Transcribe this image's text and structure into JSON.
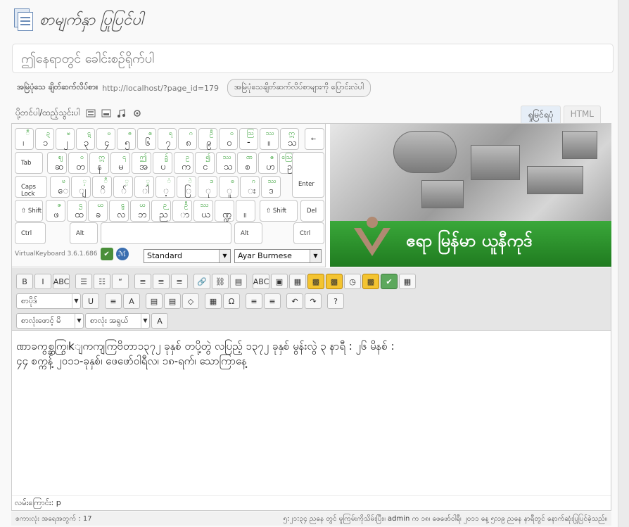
{
  "header": {
    "title": "စာမျက်နှာ ပြုပြင်ပါ"
  },
  "title_field": {
    "placeholder": "ဤနေရာတွင် ခေါင်းစဉ်ရိုက်ပါ"
  },
  "permalink": {
    "label": "အမြဲပုံသေ ချိတ်ဆက်လိပ်စာ။",
    "url": "http://localhost/?page_id=179",
    "button": "အမြဲပုံသေချိတ်ဆက်လိပ်စာများကို ပြောင်းလဲပါ"
  },
  "media": {
    "label": "ပို့တင်ပါ/ထည့်သွင်းပါ"
  },
  "tabs": [
    {
      "label": "ရှုမြင်ရပုံ"
    },
    {
      "label": "HTML"
    }
  ],
  "keyboard": {
    "row1": [
      {
        "m": "၊",
        "s": "ဳ"
      },
      {
        "m": "၁",
        "s": "ဍ"
      },
      {
        "m": "၂",
        "s": "ၑ"
      },
      {
        "m": "၃",
        "s": "ဋ"
      },
      {
        "m": "၄",
        "s": "ၓ"
      },
      {
        "m": "၅",
        "s": "ၔ"
      },
      {
        "m": "၆",
        "s": "ၕ"
      },
      {
        "m": "၇",
        "s": "ရ"
      },
      {
        "m": "၈",
        "s": "ဂ"
      },
      {
        "m": "၉",
        "s": "ဦ"
      },
      {
        "m": "၀",
        "s": "ဝ"
      },
      {
        "m": "-",
        "s": "ဩ"
      },
      {
        "m": "။",
        "s": "ဿ"
      },
      {
        "m": "သ",
        "s": "ဣ"
      }
    ],
    "row2": [
      {
        "m": "ဆ",
        "s": "ဈ"
      },
      {
        "m": "တ",
        "s": "ဝ"
      },
      {
        "m": "န",
        "s": "ဣ"
      },
      {
        "m": "မ",
        "s": "၎"
      },
      {
        "m": "အ",
        "s": "ဤ"
      },
      {
        "m": "ပ",
        "s": "၌"
      },
      {
        "m": "က",
        "s": "ဥ"
      },
      {
        "m": "င",
        "s": "၍"
      },
      {
        "m": "သ",
        "s": "ဿ"
      },
      {
        "m": "စ",
        "s": "ဏ"
      },
      {
        "m": "ဟ",
        "s": "ဧ"
      },
      {
        "m": "ဥ",
        "s": "ဪ"
      }
    ],
    "row3": [
      {
        "m": "ေ",
        "s": "ဗ"
      },
      {
        "m": "ျ",
        "s": "ှ"
      },
      {
        "m": "ိ",
        "s": "ီ"
      },
      {
        "m": "်",
        "s": "္"
      },
      {
        "m": "ါ",
        "s": "ွ"
      },
      {
        "m": "့",
        "s": "ံ"
      },
      {
        "m": "ြ",
        "s": "ဲ"
      },
      {
        "m": "ု",
        "s": "ဒ"
      },
      {
        "m": "ူ",
        "s": "ဓ"
      },
      {
        "m": "း",
        "s": "ဂ"
      },
      {
        "m": "ဒ",
        "s": "ဿ"
      }
    ],
    "row4": [
      {
        "m": "ဖ",
        "s": "ဇ"
      },
      {
        "m": "ထ",
        "s": "ဌ"
      },
      {
        "m": "ခ",
        "s": "ဃ"
      },
      {
        "m": "လ",
        "s": "ဠ"
      },
      {
        "m": "ဘ",
        "s": "ယ"
      },
      {
        "m": "ည",
        "s": "ဉ"
      },
      {
        "m": "ာ",
        "s": "ဦ"
      },
      {
        "m": "ယ",
        "s": "ဿ"
      },
      {
        "m": "ဏ္ဍ",
        "s": ""
      },
      {
        "m": "။",
        "s": ""
      }
    ],
    "labels": {
      "tab": "Tab",
      "caps": "Caps Lock",
      "enter": "Enter",
      "shift_l": "⇧ Shift",
      "shift_r": "⇧ Shift",
      "del": "Del",
      "ctrl_l": "Ctrl",
      "alt_l": "Alt",
      "alt_r": "Alt",
      "ctrl_r": "Ctrl",
      "back": "←"
    },
    "version": "VirtualKeyboard 3.6.1.686",
    "layout_select": "Standard",
    "lang_select": "Ayar Burmese"
  },
  "banner": {
    "brand": "ဧရာ မြန်မာ ယူနီကုဒ်"
  },
  "toolbar": {
    "row1": [
      "B",
      "I",
      "ABC",
      "☰",
      "☷",
      "“",
      "≡",
      "≡",
      "≡",
      "🔗",
      "⛓",
      "▤",
      "ABC",
      "▣",
      "▦",
      "▩",
      "▩",
      "◷",
      "▩",
      "✔",
      "▦"
    ],
    "row2_sel1": "စာပိုဒ်",
    "row2": [
      "U",
      "≡",
      "A",
      "▤",
      "▤",
      "◇",
      "▦",
      "Ω",
      "≡",
      "≡",
      "↶",
      "↷",
      "?"
    ],
    "row3_sel1": "စာလုံးဖောင့် မိ",
    "row3_sel2": "စာလုံး အရွယ်",
    "row3_btn": "A"
  },
  "content": {
    "line1": "ဏာခကွစ္ဆကြွ၊kျကကျကြဗိတာ၁၃၇၂ ခုနှစ် တပို့တွဲ လပြည့် ၁၃၇၂ ခုနှစ် မွန်းလွဲ ၃ နာရီ : ၂၆ မိနစ် :",
    "line2": "၄၄ စက္ကန့် ၂၀၁၁-ခုနှစ်၊ ဖေဖော်ဝါရီလ၊ ၁၈-ရက်၊ သောကြာနေ့"
  },
  "path": {
    "label": "လမ်းကြောင်း: p"
  },
  "status": {
    "wordcount": "စကားလုံး အရေအတွက် : 17",
    "saved": "၅:၂၁:၃၄ ညနေ တွင် မူကြမ်းကိုသိမ်းပြီး။ admin က ၁၈၊ ဖေဖော်ဝါရီ၊ ၂၀၁၁ နေ့ ၅:၀၉ ညနေ နာရီတွင် နောက်ဆုံးပြုပြင်ခဲ့သည်။"
  }
}
